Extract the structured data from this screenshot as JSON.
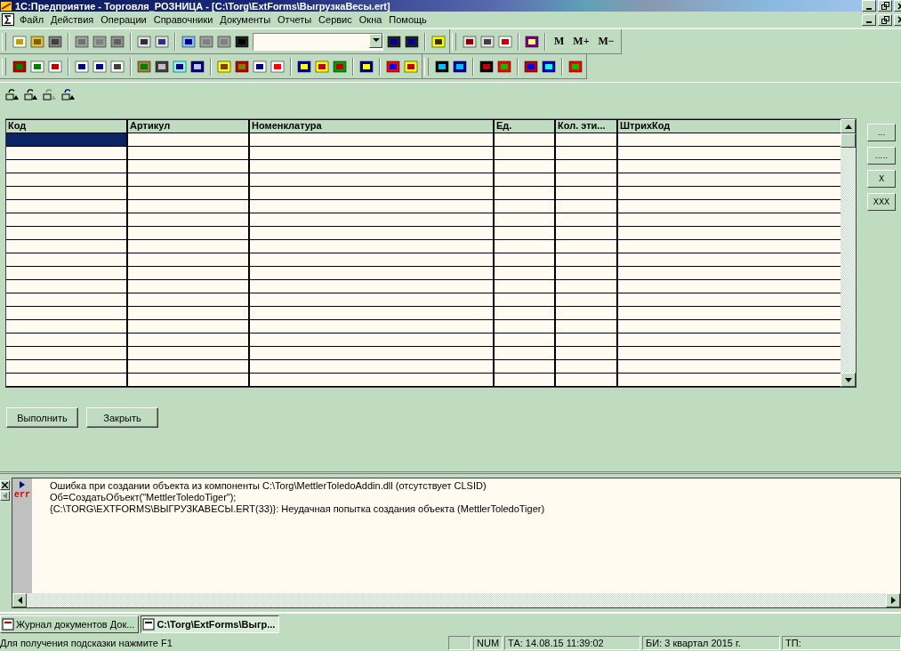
{
  "window": {
    "title": "1С:Предприятие - Торговля_РОЗНИЦА - [C:\\Torg\\ExtForms\\ВыгрузкаВесы.ert]"
  },
  "menu": [
    "Файл",
    "Действия",
    "Операции",
    "Справочники",
    "Документы",
    "Отчеты",
    "Сервис",
    "Окна",
    "Помощь"
  ],
  "toolbar": {
    "memory_buttons": [
      "M",
      "M+",
      "M−"
    ]
  },
  "table": {
    "columns": [
      "Код",
      "Артикул",
      "Номенклатура",
      "Ед.",
      "Кол. эти...",
      "ШтрихКод"
    ],
    "rows": [
      {
        "selected": true
      },
      {
        "selected": false
      },
      {
        "selected": false
      },
      {
        "selected": false
      },
      {
        "selected": false
      },
      {
        "selected": false
      },
      {
        "selected": false
      },
      {
        "selected": false
      },
      {
        "selected": false
      },
      {
        "selected": false
      },
      {
        "selected": false
      },
      {
        "selected": false
      },
      {
        "selected": false
      },
      {
        "selected": false
      },
      {
        "selected": false
      },
      {
        "selected": false
      },
      {
        "selected": false
      },
      {
        "selected": false
      },
      {
        "selected": false
      }
    ]
  },
  "side_buttons": [
    "...",
    ".....",
    "X",
    "XXX"
  ],
  "buttons": [
    "Выполнить",
    "Закрыть"
  ],
  "messages": {
    "marker": "err",
    "lines": [
      "Ошибка при создании объекта из компоненты C:\\Torg\\MettlerToledoAddin.dll (отсутствует CLSID)",
      "Об=СоздатьОбъект(\"MettlerToledoTiger\");",
      "{C:\\TORG\\EXTFORMS\\ВЫГРУЗКАВЕСЫ.ERT(33)}: Неудачная попытка создания объекта (MettlerToledoTiger)"
    ]
  },
  "taskbar": [
    {
      "label": "Журнал документов  Док...",
      "selected": false
    },
    {
      "label": "C:\\Torg\\ExtForms\\Выгр...",
      "selected": true
    }
  ],
  "status_bar": {
    "hint": "Для получения подсказки нажмите F1",
    "num": "NUM",
    "ta": "ТА: 14.08.15  11:39:02",
    "bi": "БИ: 3 квартал 2015 г.",
    "tp": "ТП:"
  }
}
